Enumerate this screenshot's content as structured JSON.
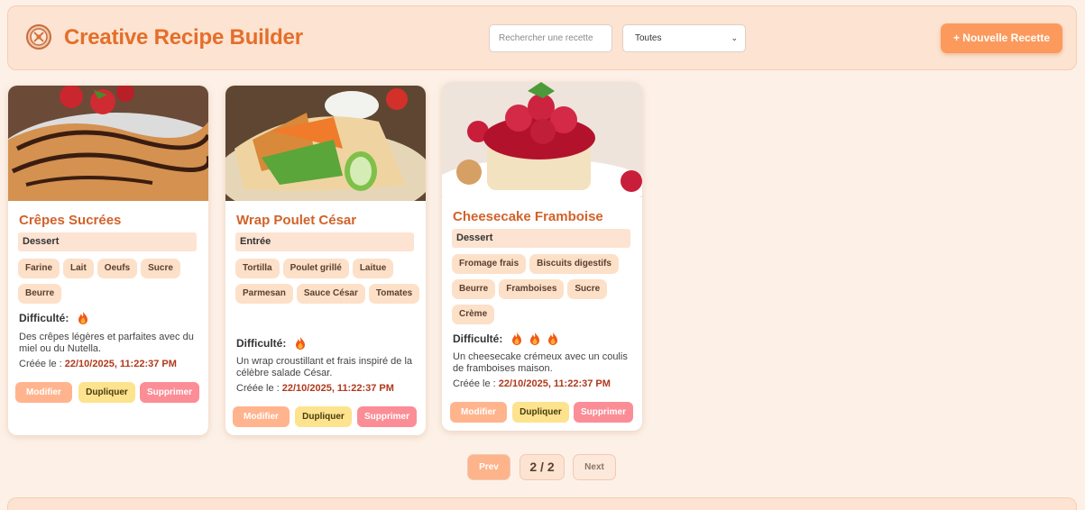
{
  "header": {
    "title": "Creative Recipe Builder",
    "search_placeholder": "Rechercher une recette",
    "filter_value": "Toutes",
    "new_button": "+ Nouvelle Recette"
  },
  "labels": {
    "difficulty": "Difficulté:",
    "created_prefix": "Créée le :",
    "modify": "Modifier",
    "duplicate": "Dupliquer",
    "delete": "Supprimer"
  },
  "recipes": [
    {
      "title": "Crêpes Sucrées",
      "category": "Dessert",
      "tags": [
        "Farine",
        "Lait",
        "Oeufs",
        "Sucre",
        "Beurre"
      ],
      "difficulty": 1,
      "description": "Des crêpes légères et parfaites avec du miel ou du Nutella.",
      "created": "22/10/2025, 11:22:37 PM"
    },
    {
      "title": "Wrap Poulet César",
      "category": "Entrée",
      "tags": [
        "Tortilla",
        "Poulet grillé",
        "Laitue",
        "Parmesan",
        "Sauce César",
        "Tomates"
      ],
      "difficulty": 1,
      "description": "Un wrap croustillant et frais inspiré de la célèbre salade César.",
      "created": "22/10/2025, 11:22:37 PM"
    },
    {
      "title": "Cheesecake Framboise",
      "category": "Dessert",
      "tags": [
        "Fromage frais",
        "Biscuits digestifs",
        "Beurre",
        "Framboises",
        "Sucre",
        "Crème"
      ],
      "difficulty": 3,
      "description": "Un cheesecake crémeux avec un coulis de framboises maison.",
      "created": "22/10/2025, 11:22:37 PM"
    }
  ],
  "pagination": {
    "prev": "Prev",
    "page": "2 / 2",
    "next": "Next"
  },
  "colors": {
    "accent": "#e56e2a",
    "background": "#fdf1e7",
    "tag": "#fde0c8",
    "modify": "#ffb48e",
    "duplicate": "#fde38e",
    "delete": "#fb8d96"
  }
}
